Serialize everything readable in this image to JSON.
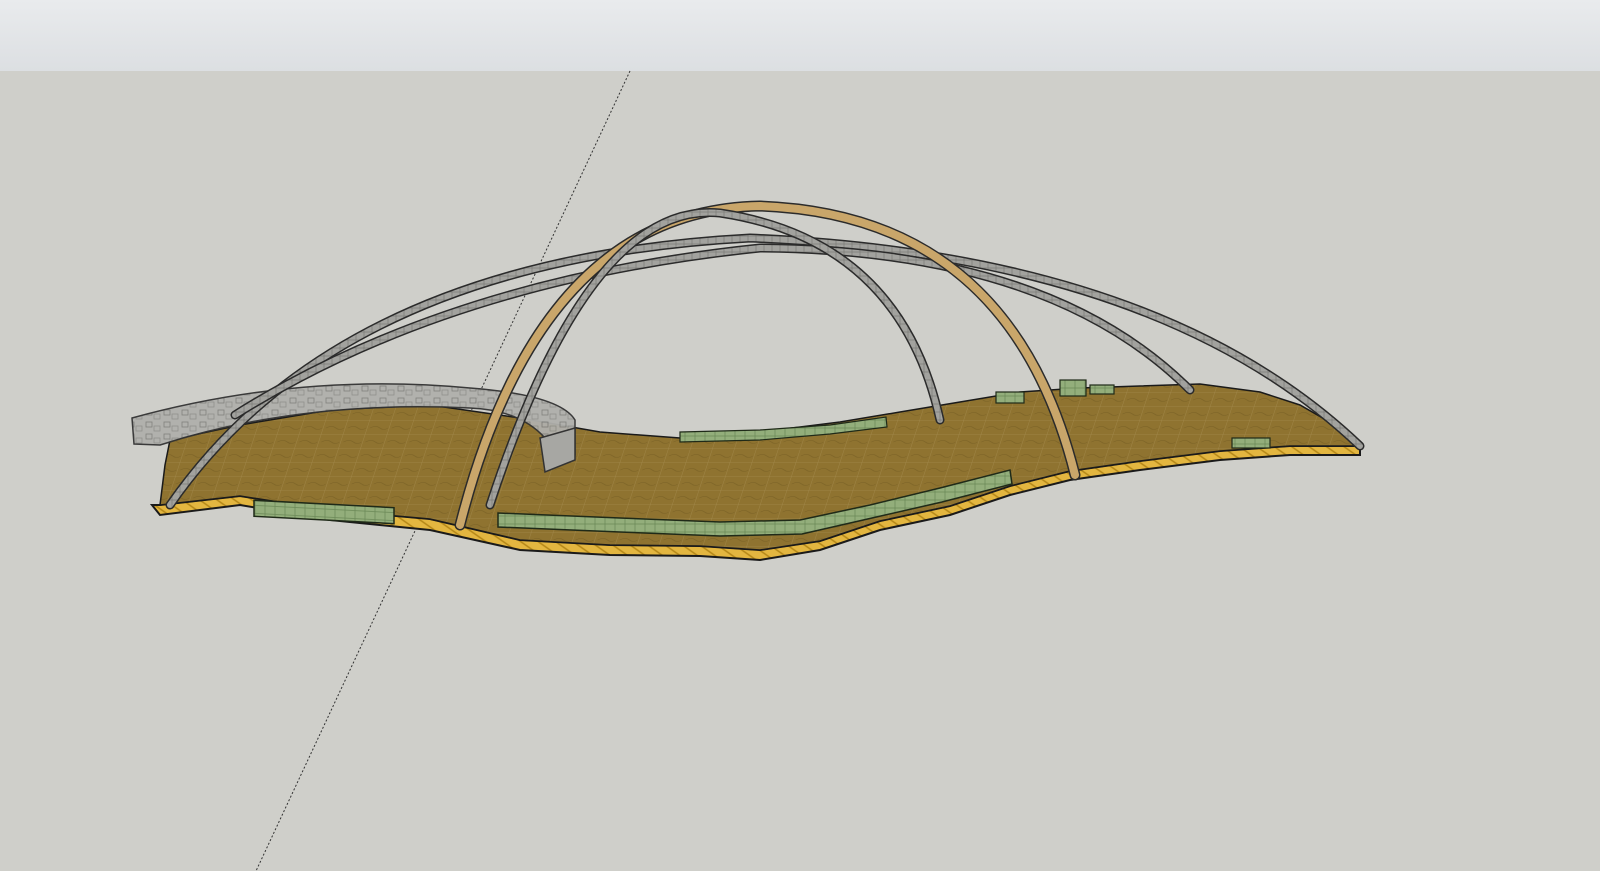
{
  "app": {
    "toolbar_label": "",
    "view_mode": "perspective-3d"
  },
  "viewport": {
    "background_color": "#cfcfca"
  },
  "model": {
    "components": [
      {
        "name": "terrain-deck",
        "color": "#8f7330"
      },
      {
        "name": "deck-edge",
        "color": "#e3b640"
      },
      {
        "name": "curved-wall",
        "color": "#a9a9a5"
      },
      {
        "name": "arches",
        "color": "#9a9a96"
      },
      {
        "name": "planters",
        "color": "#8faa78"
      }
    ],
    "axis_color": "#333333"
  }
}
